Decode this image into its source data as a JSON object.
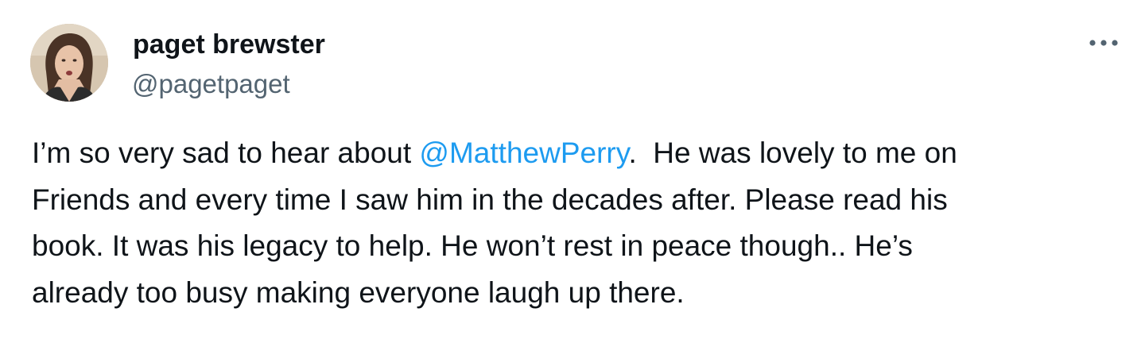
{
  "author": {
    "display_name": "paget brewster",
    "handle": "@pagetpaget",
    "avatar": "profile-photo"
  },
  "more_icon": "more-horizontal-icon",
  "tweet": {
    "line1_before": "I’m so very sad to hear about ",
    "line1_mention": "@MatthewPerry",
    "line1_after": ".  He was lovely to me on",
    "line2": "Friends and every time I saw him in the decades after. Please read his",
    "line3": "book. It was his legacy to help. He won’t rest in peace though.. He’s",
    "line4": "already too busy making everyone laugh up there."
  },
  "colors": {
    "text": "#0f1419",
    "secondary": "#536471",
    "accent": "#1d9bf0",
    "background": "#ffffff"
  }
}
